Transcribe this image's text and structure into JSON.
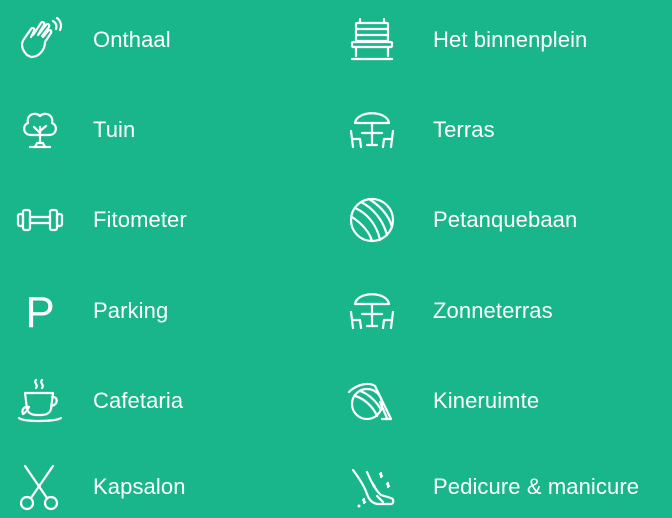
{
  "facilities": {
    "left": [
      {
        "icon": "waving-hand-icon",
        "label": "Onthaal"
      },
      {
        "icon": "tree-icon",
        "label": "Tuin"
      },
      {
        "icon": "dumbbell-icon",
        "label": "Fitometer"
      },
      {
        "icon": "parking-icon",
        "label": "Parking"
      },
      {
        "icon": "coffee-cup-icon",
        "label": "Cafetaria"
      },
      {
        "icon": "scissors-icon",
        "label": "Kapsalon"
      }
    ],
    "right": [
      {
        "icon": "bench-icon",
        "label": "Het binnenplein"
      },
      {
        "icon": "terrace-table-umbrella-icon",
        "label": "Terras"
      },
      {
        "icon": "petanque-ball-icon",
        "label": "Petanquebaan"
      },
      {
        "icon": "terrace-table-umbrella-icon",
        "label": "Zonneterras"
      },
      {
        "icon": "therapy-ball-icon",
        "label": "Kineruimte"
      },
      {
        "icon": "foot-care-icon",
        "label": "Pedicure & manicure"
      }
    ],
    "parking_symbol": "P"
  },
  "colors": {
    "background": "#1ab68b",
    "foreground": "#ffffff"
  }
}
